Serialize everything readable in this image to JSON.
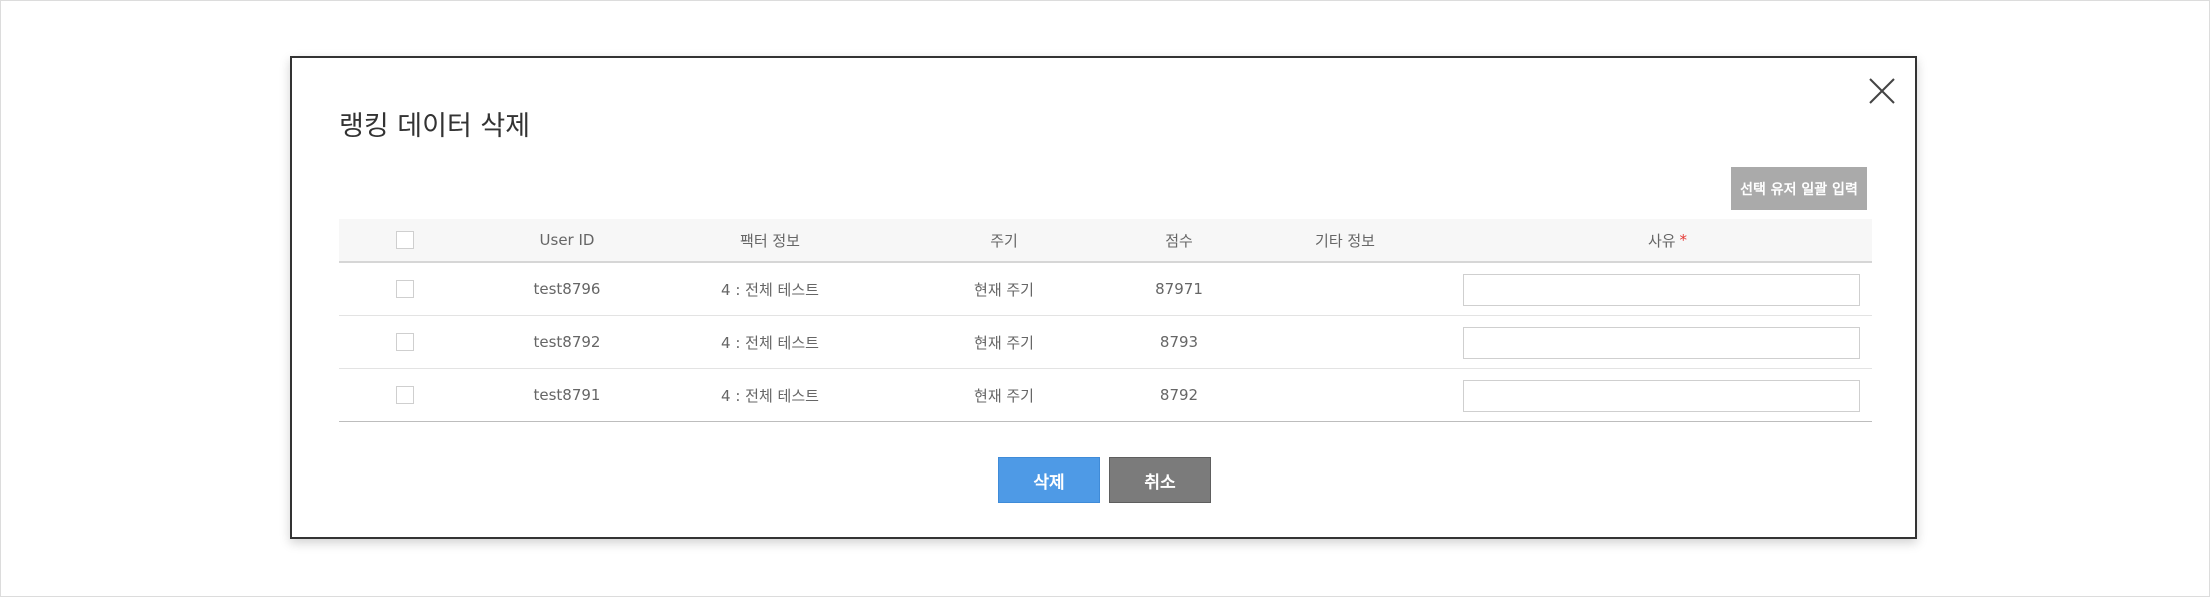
{
  "modal": {
    "title": "랭킹 데이터 삭제",
    "bulk_button": "선택 유저 일괄 입력",
    "delete_button": "삭제",
    "cancel_button": "취소"
  },
  "table": {
    "headers": {
      "user_id": "User ID",
      "factor": "팩터 정보",
      "cycle": "주기",
      "score": "점수",
      "etc": "기타 정보",
      "reason": "사유",
      "required_mark": "*"
    },
    "rows": [
      {
        "user_id": "test8796",
        "factor": "4 : 전체 테스트",
        "cycle": "현재 주기",
        "score": "87971",
        "etc": "",
        "reason": ""
      },
      {
        "user_id": "test8792",
        "factor": "4 : 전체 테스트",
        "cycle": "현재 주기",
        "score": "8793",
        "etc": "",
        "reason": ""
      },
      {
        "user_id": "test8791",
        "factor": "4 : 전체 테스트",
        "cycle": "현재 주기",
        "score": "8792",
        "etc": "",
        "reason": ""
      }
    ]
  },
  "colors": {
    "delete_button": "#4e9ae6",
    "cancel_button": "#7b7b7b",
    "bulk_button": "#aaaaaa",
    "required": "#e53935"
  }
}
